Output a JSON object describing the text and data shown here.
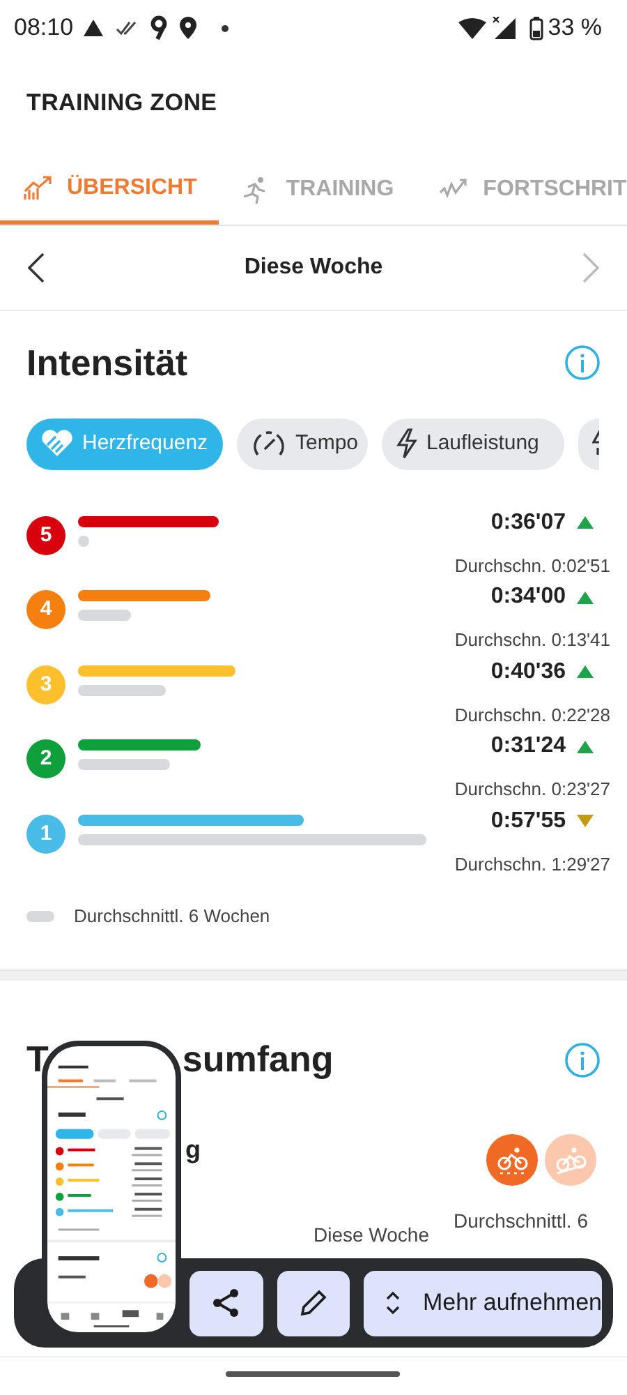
{
  "status_bar": {
    "time": "08:10",
    "battery": "33 %"
  },
  "app_title": "TRAINING ZONE",
  "tabs": [
    {
      "label": "ÜBERSICHT",
      "kind": "overview",
      "selected": true
    },
    {
      "label": "TRAINING",
      "kind": "runner",
      "selected": false
    },
    {
      "label": "FORTSCHRIT",
      "kind": "progress",
      "selected": false
    }
  ],
  "period": {
    "label": "Diese Woche",
    "next_disabled": true
  },
  "intensity": {
    "title": "Intensität",
    "chips": [
      {
        "label": "Herzfrequenz",
        "kind": "heart",
        "selected": true
      },
      {
        "label": "Tempo",
        "kind": "gauge",
        "selected": false
      },
      {
        "label": "Laufleistung",
        "kind": "bolt",
        "selected": false
      },
      {
        "kind": "cut",
        "selected": false
      }
    ],
    "zones": [
      {
        "number": "5",
        "color": "#d9000d",
        "time": "0:36'07",
        "rising": true,
        "average": "Durchschn. 0:02'51"
      },
      {
        "number": "4",
        "color": "#f57f0f",
        "time": "0:34'00",
        "rising": true,
        "average": "Durchschn. 0:13'41"
      },
      {
        "number": "3",
        "color": "#fdbf2b",
        "time": "0:40'36",
        "rising": true,
        "average": "Durchschn. 0:22'28"
      },
      {
        "number": "2",
        "color": "#0fa03c",
        "time": "0:31'24",
        "rising": true,
        "average": "Durchschn. 0:23'27"
      },
      {
        "number": "1",
        "color": "#48bbe6",
        "time": "0:57'55",
        "rising": false,
        "average": "Durchschn. 1:29'27"
      }
    ],
    "legend": "Durchschnittl. 6 Wochen"
  },
  "volume": {
    "title_start": "T",
    "title_end": "sumfang",
    "subtitle_fragment": "g",
    "sport_buttons": [
      {
        "kind": "cycling",
        "selected": true
      },
      {
        "kind": "cycling-indoor",
        "selected": false
      }
    ],
    "column_1": "Diese Woche",
    "column_2": "Durchschnittl. 6"
  },
  "screenshot_toolbar": {
    "more_label": "Mehr aufnehmen"
  }
}
